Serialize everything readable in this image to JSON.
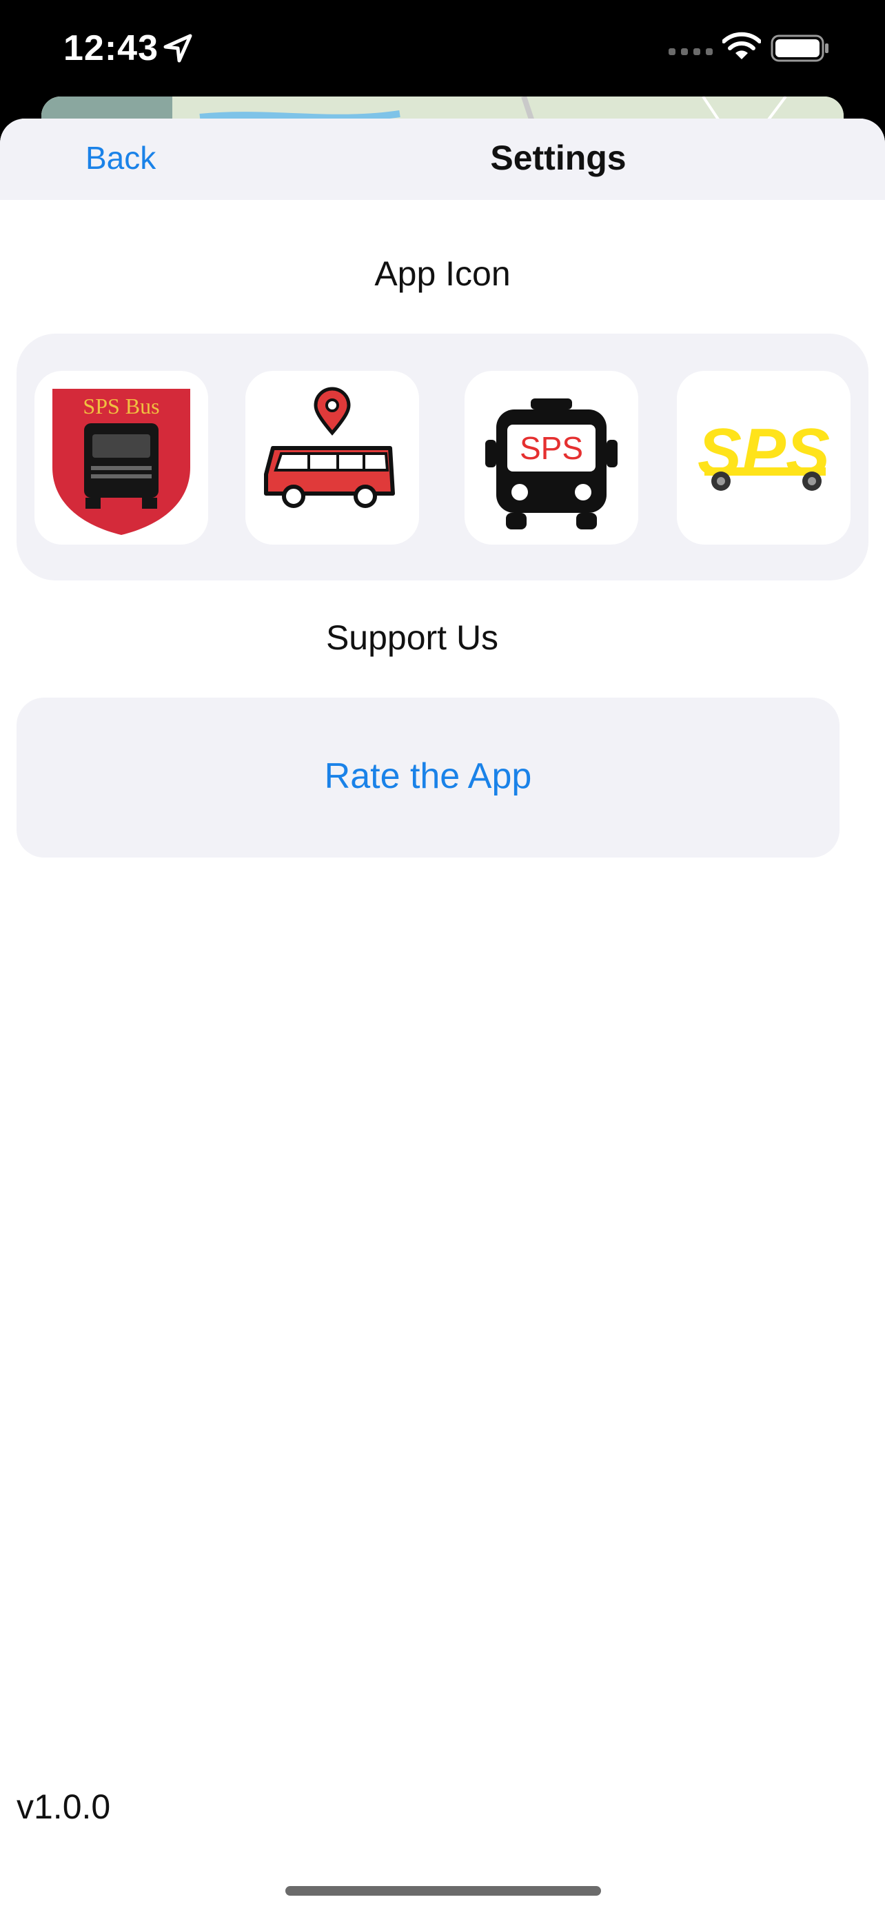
{
  "status_bar": {
    "time": "12:43"
  },
  "nav": {
    "back_label": "Back",
    "title": "Settings"
  },
  "app_icon_section": {
    "title": "App Icon",
    "icons": [
      {
        "name": "shield-bus-icon",
        "text": "SPS Bus"
      },
      {
        "name": "red-bus-pin-icon"
      },
      {
        "name": "black-bus-sps-icon",
        "text": "SPS"
      },
      {
        "name": "yellow-sps-car-icon",
        "text": "SPS"
      }
    ]
  },
  "support_section": {
    "title": "Support Us",
    "rate_label": "Rate the App"
  },
  "footer": {
    "version": "v1.0.0"
  },
  "colors": {
    "accent": "#1a82e8",
    "panel": "#f2f2f7",
    "shield_red": "#d42a3a",
    "sps_yellow": "#ffe31a"
  }
}
